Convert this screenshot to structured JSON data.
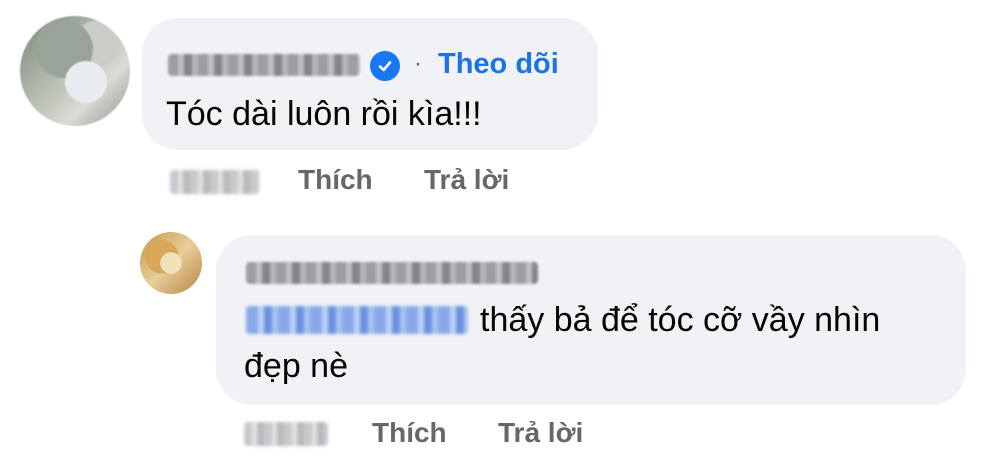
{
  "comment": {
    "author_verified": true,
    "follow_label": "Theo dõi",
    "separator": "·",
    "text": "Tóc dài luôn rồi kìa!!!",
    "actions": {
      "like": "Thích",
      "reply": "Trả lời"
    }
  },
  "reply": {
    "text_line1": "thấy bả để tóc cỡ vầy nhìn",
    "text_line2": "đẹp nè",
    "actions": {
      "like": "Thích",
      "reply": "Trả lời"
    }
  },
  "colors": {
    "bubble": "#f0f2f5",
    "link": "#1b74e4",
    "secondary_text": "#65676b",
    "primary_text": "#050505"
  },
  "icons": {
    "verified": "verified-badge-icon"
  }
}
